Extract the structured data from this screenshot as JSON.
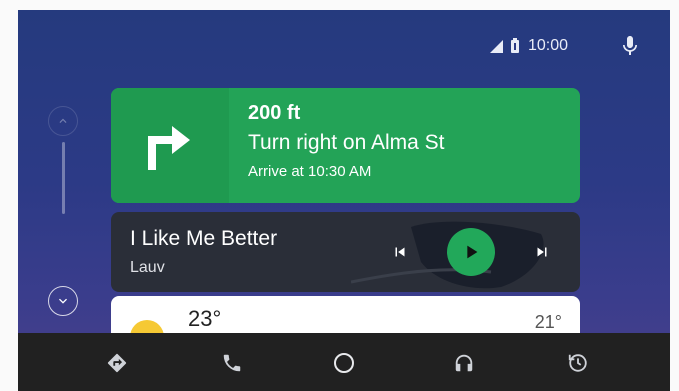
{
  "status": {
    "time": "10:00",
    "icons": [
      "signal-icon",
      "battery-icon",
      "microphone-icon"
    ]
  },
  "scroll": {
    "up_icon": "chevron-up-icon",
    "down_icon": "chevron-down-icon"
  },
  "navigation": {
    "maneuver_icon": "turn-right-icon",
    "distance": "200 ft",
    "instruction": "Turn right on Alma St",
    "arrival": "Arrive at 10:30 AM",
    "color": "#23a357"
  },
  "media": {
    "title": "I Like Me Better",
    "artist": "Lauv",
    "controls": [
      "skip-previous-icon",
      "play-icon",
      "skip-next-icon"
    ],
    "accent": "#22a85a"
  },
  "weather": {
    "icon": "sun-icon",
    "current_temp": "23°",
    "other_temp": "21°"
  },
  "dock": {
    "items": [
      "navigation-icon",
      "phone-icon",
      "home-icon",
      "headphones-icon",
      "recents-icon"
    ]
  }
}
